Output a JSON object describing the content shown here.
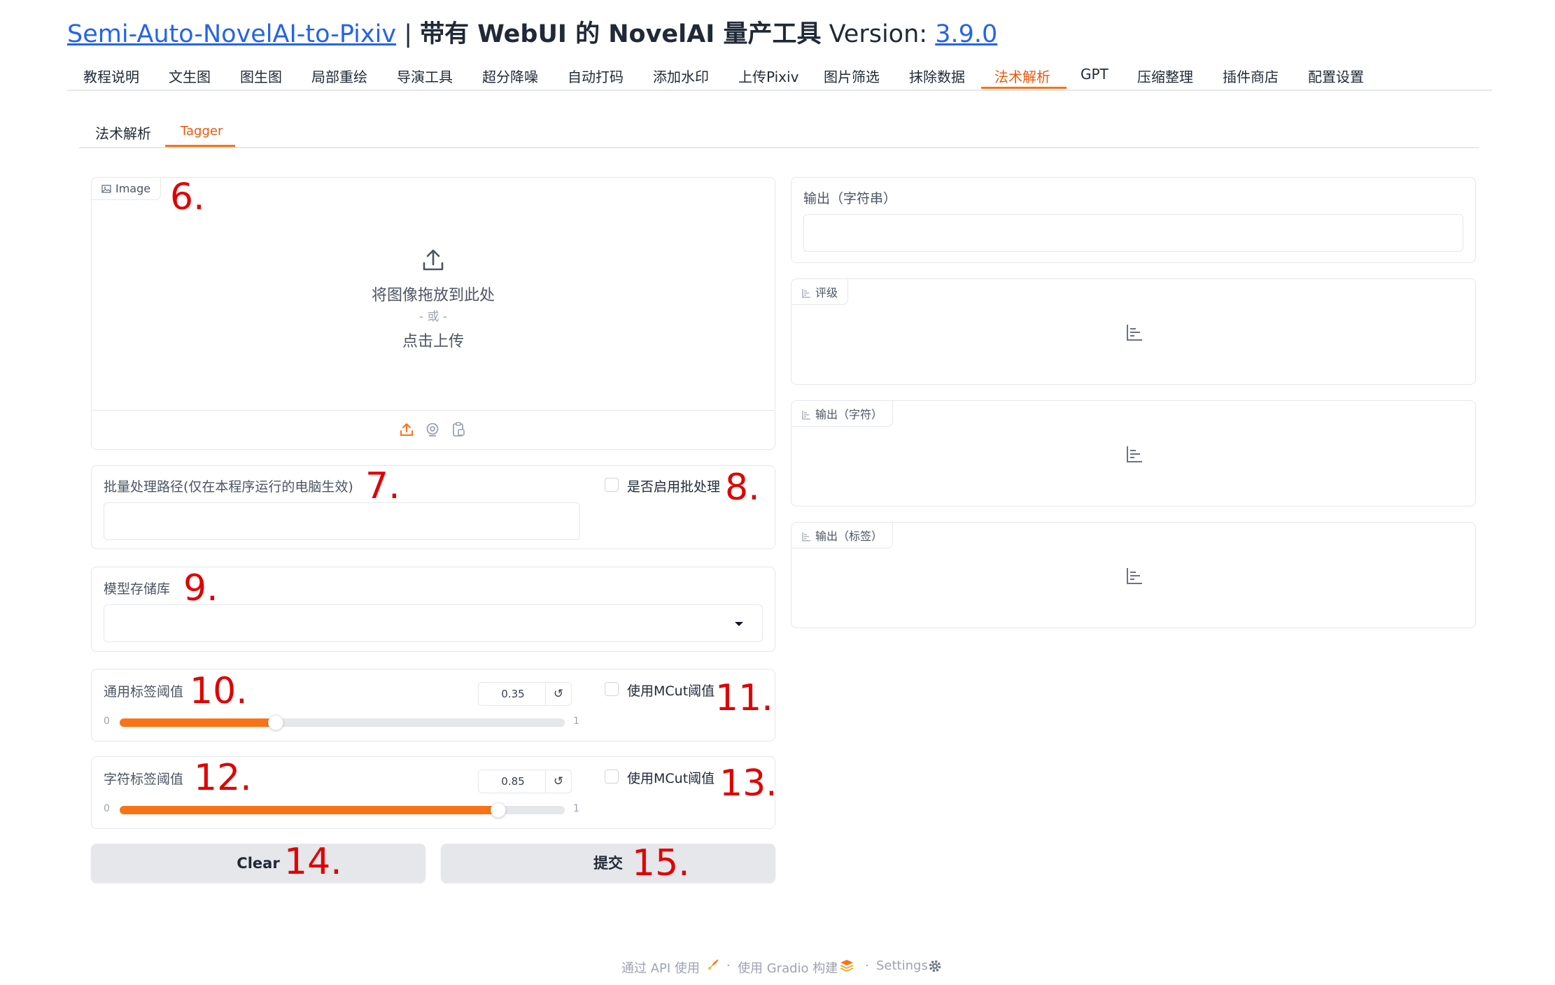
{
  "header": {
    "app_link": "Semi-Auto-NovelAI-to-Pixiv",
    "separator": " | ",
    "subtitle": "带有 WebUI 的 NovelAI 量产工具",
    "version_label": " Version: ",
    "version": "3.9.0"
  },
  "main_tabs": [
    "教程说明",
    "文生图",
    "图生图",
    "局部重绘",
    "导演工具",
    "超分降噪",
    "自动打码",
    "添加水印",
    "上传Pixiv",
    "图片筛选",
    "抹除数据",
    "法术解析",
    "GPT",
    "压缩整理",
    "插件商店",
    "配置设置"
  ],
  "active_main_tab": "法术解析",
  "sub_tabs": [
    "法术解析",
    "Tagger"
  ],
  "active_sub_tab": "Tagger",
  "image_upload": {
    "label": "Image",
    "drop_text": "将图像拖放到此处",
    "or_text": "- 或 -",
    "click_text": "点击上传"
  },
  "batch": {
    "path_label": "批量处理路径(仅在本程序运行的电脑生效)",
    "path_value": "",
    "enable_label": "是否启用批处理"
  },
  "model": {
    "label": "模型存储库",
    "selected": ""
  },
  "general_threshold": {
    "label": "通用标签阈值",
    "value": "0.35",
    "fraction": 0.35,
    "min": "0",
    "max": "1",
    "mcut_label": "使用MCut阈值"
  },
  "character_threshold": {
    "label": "字符标签阈值",
    "value": "0.85",
    "fraction": 0.85,
    "min": "0",
    "max": "1",
    "mcut_label": "使用MCut阈值"
  },
  "buttons": {
    "clear": "Clear",
    "submit": "提交"
  },
  "outputs": {
    "string_label": "输出（字符串）",
    "string_value": "",
    "rating_label": "评级",
    "character_label": "输出（字符）",
    "tags_label": "输出（标签）"
  },
  "annotations": [
    "6.",
    "7.",
    "8.",
    "9.",
    "10.",
    "11.",
    "12.",
    "13.",
    "14.",
    "15."
  ],
  "footer": {
    "api": "通过 API 使用",
    "dot": "·",
    "gradio": "使用 Gradio 构建",
    "settings": "Settings"
  },
  "colors": {
    "accent": "#f97316",
    "link": "#2563eb",
    "annotation": "#e00000"
  },
  "icons": [
    "upload-icon",
    "webcam-icon",
    "clipboard-icon",
    "image-icon",
    "bar-chart-icon",
    "reset-icon",
    "chevron-down-icon",
    "rocket-icon",
    "gradio-logo-icon",
    "gear-icon"
  ]
}
